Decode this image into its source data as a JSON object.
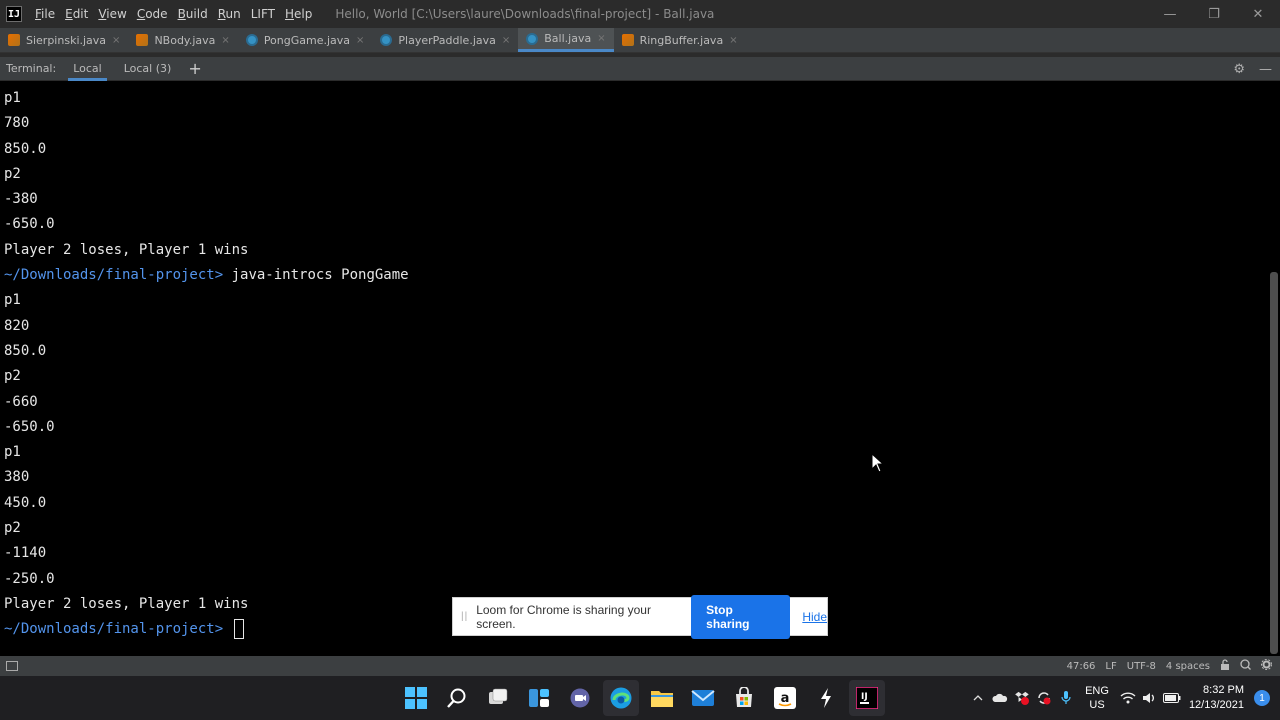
{
  "titlebar": {
    "logo": "IJ",
    "menu": [
      {
        "ul": "F",
        "rest": "ile"
      },
      {
        "ul": "E",
        "rest": "dit"
      },
      {
        "ul": "V",
        "rest": "iew"
      },
      {
        "ul": "C",
        "rest": "ode"
      },
      {
        "ul": "B",
        "rest": "uild"
      },
      {
        "ul": "R",
        "rest": "un"
      },
      {
        "ul": "",
        "rest": "LIFT"
      },
      {
        "ul": "H",
        "rest": "elp"
      }
    ],
    "title": "Hello, World [C:\\Users\\laure\\Downloads\\final-project] - Ball.java",
    "controls": {
      "minimize": "—",
      "restore": "❐",
      "close": "✕"
    }
  },
  "tabs": [
    {
      "label": "Sierpinski.java",
      "icon": "java"
    },
    {
      "label": "NBody.java",
      "icon": "java"
    },
    {
      "label": "PongGame.java",
      "icon": "cls"
    },
    {
      "label": "PlayerPaddle.java",
      "icon": "cls"
    },
    {
      "label": "Ball.java",
      "icon": "cls",
      "active": true
    },
    {
      "label": "RingBuffer.java",
      "icon": "java"
    }
  ],
  "tab_close": "×",
  "terminal_header": {
    "label": "Terminal:",
    "tabs": [
      "Local",
      "Local (3)"
    ],
    "add": "+",
    "settings": "⚙",
    "hide": "—"
  },
  "terminal": {
    "lines": [
      {
        "text": "p1"
      },
      {
        "text": "780"
      },
      {
        "text": "850.0"
      },
      {
        "text": "p2"
      },
      {
        "text": "-380"
      },
      {
        "text": "-650.0"
      },
      {
        "text": "Player 2 loses, Player 1 wins"
      },
      {
        "prompt": "~/Downloads/final-project>",
        "text": " java-introcs PongGame"
      },
      {
        "text": "p1"
      },
      {
        "text": "820"
      },
      {
        "text": "850.0"
      },
      {
        "text": "p2"
      },
      {
        "text": "-660"
      },
      {
        "text": "-650.0"
      },
      {
        "text": "p1"
      },
      {
        "text": "380"
      },
      {
        "text": "450.0"
      },
      {
        "text": "p2"
      },
      {
        "text": "-1140"
      },
      {
        "text": "-250.0"
      },
      {
        "text": "Player 2 loses, Player 1 wins"
      },
      {
        "prompt": "~/Downloads/final-project>",
        "text": " ",
        "cursor": true
      }
    ]
  },
  "loom": {
    "grip": "||",
    "message": "Loom for Chrome is sharing your screen.",
    "stop_label": "Stop sharing",
    "hide_label": "Hide"
  },
  "statusbar": {
    "position": "47:66",
    "line_sep": "LF",
    "encoding": "UTF-8",
    "indent": "4 spaces"
  },
  "tray": {
    "lang_top": "ENG",
    "lang_bottom": "US",
    "time": "8:32 PM",
    "date": "12/13/2021",
    "notifications": "1"
  },
  "colors": {
    "accent": "#4a88c7",
    "prompt": "#5394ec",
    "loom_button": "#1a73e8"
  }
}
